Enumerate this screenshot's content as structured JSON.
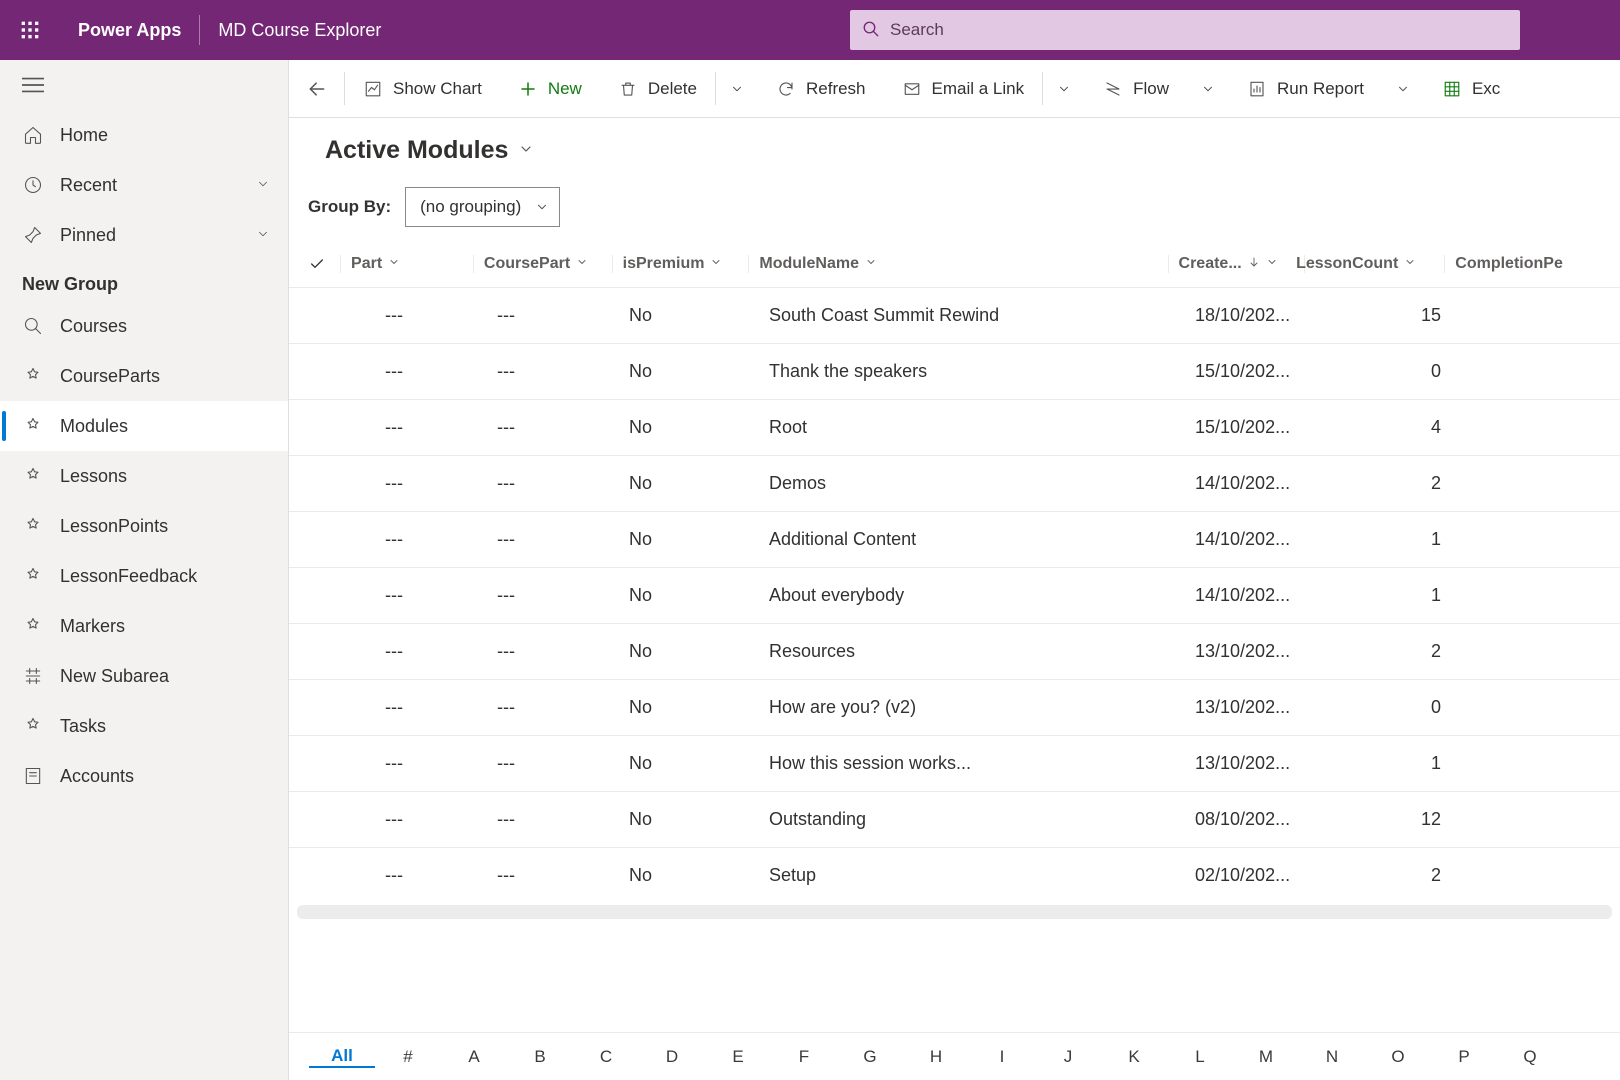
{
  "header": {
    "app_name": "Power Apps",
    "env_name": "MD Course Explorer",
    "search_placeholder": "Search"
  },
  "sidebar": {
    "home": "Home",
    "recent": "Recent",
    "pinned": "Pinned",
    "group_title": "New Group",
    "items": [
      "Courses",
      "CourseParts",
      "Modules",
      "Lessons",
      "LessonPoints",
      "LessonFeedback",
      "Markers",
      "New Subarea",
      "Tasks",
      "Accounts"
    ],
    "active_index": 2
  },
  "commands": {
    "show_chart": "Show Chart",
    "new": "New",
    "delete": "Delete",
    "refresh": "Refresh",
    "email": "Email a Link",
    "flow": "Flow",
    "run_report": "Run Report",
    "excel": "Exc"
  },
  "view": {
    "title": "Active Modules",
    "group_by_label": "Group By:",
    "group_by_value": "(no grouping)"
  },
  "columns": {
    "part": "Part",
    "coursepart": "CoursePart",
    "ispremium": "isPremium",
    "modulename": "ModuleName",
    "created": "Create...",
    "lessoncount": "LessonCount",
    "completion": "CompletionPe"
  },
  "rows": [
    {
      "part": "---",
      "cpart": "---",
      "prem": "No",
      "name": "South Coast Summit Rewind",
      "created": "18/10/202...",
      "lcount": "15"
    },
    {
      "part": "---",
      "cpart": "---",
      "prem": "No",
      "name": "Thank the speakers",
      "created": "15/10/202...",
      "lcount": "0"
    },
    {
      "part": "---",
      "cpart": "---",
      "prem": "No",
      "name": "Root",
      "created": "15/10/202...",
      "lcount": "4"
    },
    {
      "part": "---",
      "cpart": "---",
      "prem": "No",
      "name": "Demos",
      "created": "14/10/202...",
      "lcount": "2"
    },
    {
      "part": "---",
      "cpart": "---",
      "prem": "No",
      "name": "Additional Content",
      "created": "14/10/202...",
      "lcount": "1"
    },
    {
      "part": "---",
      "cpart": "---",
      "prem": "No",
      "name": "About everybody",
      "created": "14/10/202...",
      "lcount": "1"
    },
    {
      "part": "---",
      "cpart": "---",
      "prem": "No",
      "name": "Resources",
      "created": "13/10/202...",
      "lcount": "2"
    },
    {
      "part": "---",
      "cpart": "---",
      "prem": "No",
      "name": "How are you? (v2)",
      "created": "13/10/202...",
      "lcount": "0"
    },
    {
      "part": "---",
      "cpart": "---",
      "prem": "No",
      "name": "How this session works...",
      "created": "13/10/202...",
      "lcount": "1"
    },
    {
      "part": "---",
      "cpart": "---",
      "prem": "No",
      "name": "Outstanding",
      "created": "08/10/202...",
      "lcount": "12"
    },
    {
      "part": "---",
      "cpart": "---",
      "prem": "No",
      "name": "Setup",
      "created": "02/10/202...",
      "lcount": "2"
    }
  ],
  "jumpbar": [
    "All",
    "#",
    "A",
    "B",
    "C",
    "D",
    "E",
    "F",
    "G",
    "H",
    "I",
    "J",
    "K",
    "L",
    "M",
    "N",
    "O",
    "P",
    "Q"
  ]
}
